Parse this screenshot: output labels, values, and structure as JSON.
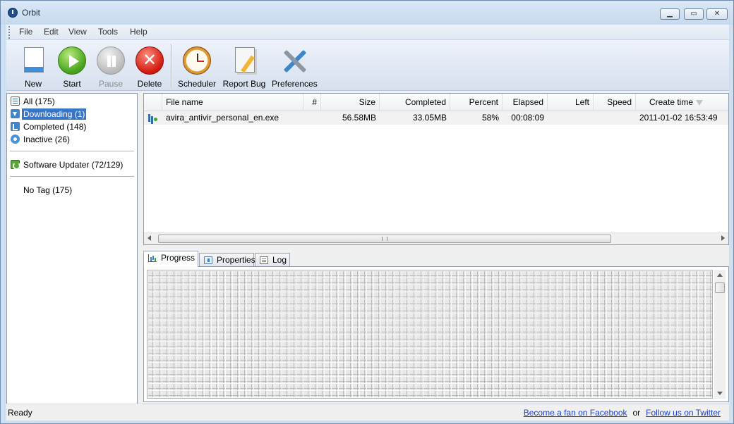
{
  "window": {
    "title": "Orbit",
    "min_glyph": "▁",
    "max_glyph": "▭",
    "close_glyph": "✕"
  },
  "menu": [
    "File",
    "Edit",
    "View",
    "Tools",
    "Help"
  ],
  "toolbar": {
    "new": "New",
    "start": "Start",
    "pause": "Pause",
    "delete": "Delete",
    "scheduler": "Scheduler",
    "report_bug": "Report Bug",
    "preferences": "Preferences",
    "pause_disabled": true
  },
  "sidebar": {
    "categories": [
      {
        "label": "All (175)",
        "icon": "list-icon"
      },
      {
        "label": "Downloading (1)",
        "icon": "download-icon",
        "selected": true
      },
      {
        "label": "Completed (148)",
        "icon": "completed-icon"
      },
      {
        "label": "Inactive (26)",
        "icon": "inactive-icon"
      }
    ],
    "software_updater": "Software Updater (72/129)",
    "no_tag": "No Tag (175)"
  },
  "list": {
    "columns": {
      "file_name": "File name",
      "num": "#",
      "size": "Size",
      "completed": "Completed",
      "percent": "Percent",
      "elapsed": "Elapsed",
      "left": "Left",
      "speed": "Speed",
      "create_time": "Create time"
    },
    "rows": [
      {
        "file_name": "avira_antivir_personal_en.exe",
        "num": "",
        "size": "56.58MB",
        "completed": "33.05MB",
        "percent": "58%",
        "elapsed": "00:08:09",
        "left": "",
        "speed": "",
        "create_time": "2011-01-02 16:53:49"
      }
    ]
  },
  "tabs": {
    "progress": "Progress",
    "properties": "Properties",
    "log": "Log",
    "active": "progress"
  },
  "status": {
    "text": "Ready",
    "facebook": "Become a fan on Facebook",
    "or": "or",
    "twitter": "Follow us on Twitter"
  },
  "colors": {
    "accent": "#3875c7",
    "link": "#1a3fd0",
    "window_frame": "#cfe0f2"
  }
}
